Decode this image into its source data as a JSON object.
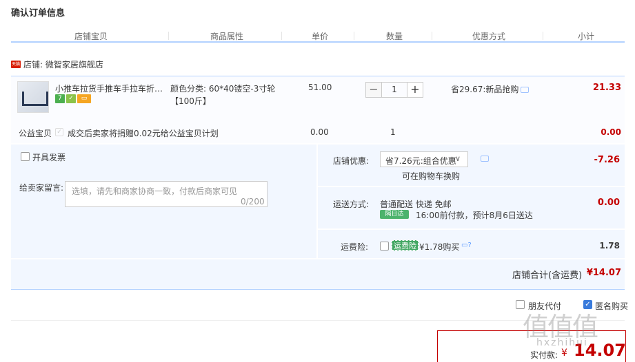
{
  "page_title": "确认订单信息",
  "columns": [
    "店铺宝贝",
    "商品属性",
    "单价",
    "数量",
    "优惠方式",
    "小计"
  ],
  "shop": {
    "badge": "天猫",
    "label": "店铺: 微智家居旗舰店"
  },
  "item": {
    "name": "小推车拉货手推车手拉车折叠轻...",
    "attr": "颜色分类: 60*40镂空-3寸轮【100斤】",
    "price": "51.00",
    "quantity": "1",
    "minus": "−",
    "plus": "+",
    "promo": "省29.67:新品抢购",
    "subtotal": "21.33",
    "badges": [
      {
        "text": "7",
        "color": "#4caf50"
      },
      {
        "text": "✓",
        "color": "#8bc34a"
      },
      {
        "text": "▭",
        "color": "#f5a623"
      }
    ]
  },
  "charity": {
    "label": "公益宝贝",
    "check": "✓",
    "text": "成交后卖家将捐赠0.02元给公益宝贝计划",
    "price": "0.00",
    "qty": "1",
    "subtotal": "0.00"
  },
  "invoice": {
    "label": "开具发票"
  },
  "message": {
    "label": "给卖家留言:",
    "placeholder": "选填，请先和商家协商一致，付款后商家可见",
    "counter": "0/200"
  },
  "shop_discount": {
    "label": "店铺优惠:",
    "selected": "省7.26元:组合优惠",
    "arrow": "∨",
    "note": "可在购物车换购",
    "amount": "-7.26"
  },
  "shipping": {
    "label": "运送方式:",
    "value": "普通配送 快递 免邮",
    "badge": "隔日达",
    "time": "16:00前付款，预计8月6日送达",
    "amount": "0.00"
  },
  "insurance": {
    "label": "运费险:",
    "tag": "运费险",
    "price": "¥1.78购买",
    "icons": "▭?",
    "amount": "1.78"
  },
  "shop_total": {
    "label": "店铺合计(含运费)",
    "value": "¥14.07"
  },
  "options": {
    "friend_pay": "朋友代付",
    "anonymous": "匿名购买",
    "anon_check": "✓"
  },
  "payment": {
    "label": "实付款:",
    "currency": "¥",
    "value": "14.07"
  },
  "watermark": {
    "big": "值值值",
    "small": "hxzhihui"
  },
  "colors": {
    "accent": "#c40000",
    "panel": "#f2f7ff",
    "rule": "#b2d1ff"
  }
}
